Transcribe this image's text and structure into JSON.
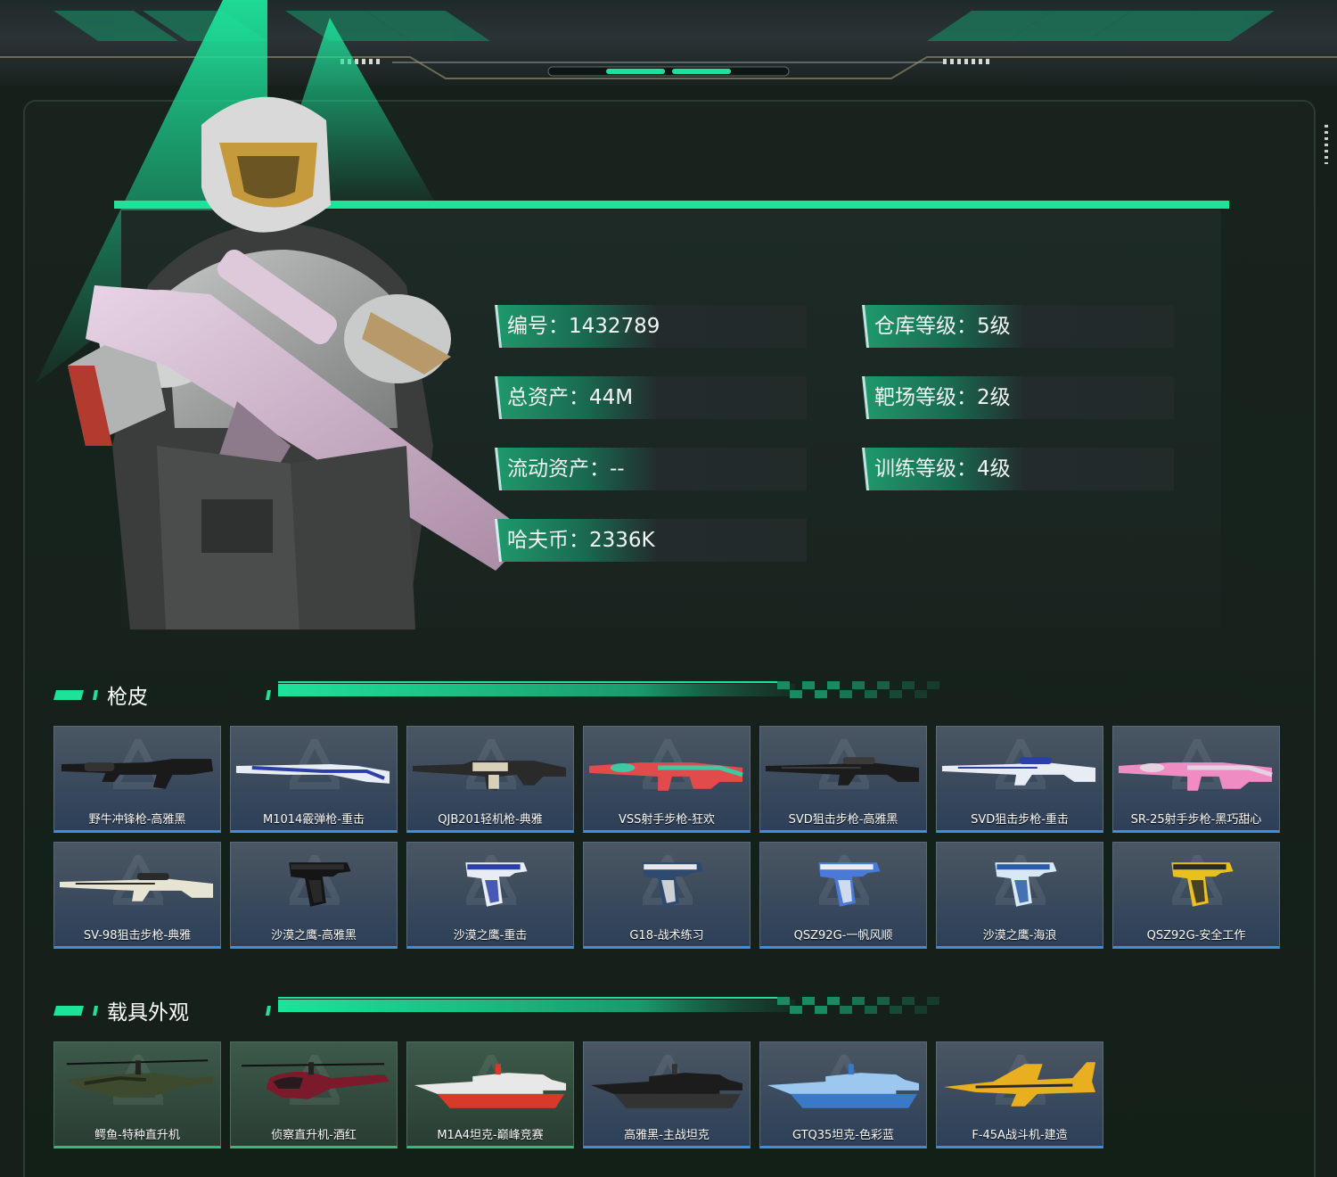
{
  "stats": {
    "id": "编号：1432789",
    "total_assets": "总资产：44M",
    "liquid_assets": "流动资产：--",
    "hafu_coin": "哈夫币：2336K",
    "warehouse_level": "仓库等级：5级",
    "range_level": "靶场等级：2级",
    "training_level": "训练等级：4级"
  },
  "sections": {
    "gun_skins": {
      "title": "枪皮",
      "items": [
        {
          "label": "野牛冲锋枪-高雅黑",
          "icon": "smg-icon",
          "colors": [
            "#1a1a1a",
            "#333"
          ]
        },
        {
          "label": "M1014霰弹枪-重击",
          "icon": "shotgun-icon",
          "colors": [
            "#e8ecf4",
            "#2a3fa8"
          ]
        },
        {
          "label": "QJB201轻机枪-典雅",
          "icon": "lmg-icon",
          "colors": [
            "#2a2a2a",
            "#d8d0b8"
          ]
        },
        {
          "label": "VSS射手步枪-狂欢",
          "icon": "marksman-rifle-icon",
          "colors": [
            "#e24b4b",
            "#3fc9a2"
          ]
        },
        {
          "label": "SVD狙击步枪-高雅黑",
          "icon": "sniper-rifle-icon",
          "colors": [
            "#1c1c1c",
            "#3a3a3a"
          ]
        },
        {
          "label": "SVD狙击步枪-重击",
          "icon": "sniper-rifle-icon",
          "colors": [
            "#e8ecf4",
            "#2a3fa8"
          ]
        },
        {
          "label": "SR-25射手步枪-黑巧甜心",
          "icon": "marksman-rifle-icon",
          "colors": [
            "#f08cc4",
            "#e4d2e2"
          ]
        },
        {
          "label": "SV-98狙击步枪-典雅",
          "icon": "sniper-rifle-icon",
          "colors": [
            "#e8e4d4",
            "#2a2a2a"
          ]
        },
        {
          "label": "沙漠之鹰-高雅黑",
          "icon": "pistol-icon",
          "colors": [
            "#151515",
            "#2c2c2c"
          ]
        },
        {
          "label": "沙漠之鹰-重击",
          "icon": "pistol-icon",
          "colors": [
            "#e8ecf4",
            "#2a3fa8"
          ]
        },
        {
          "label": "G18-战术练习",
          "icon": "pistol-icon",
          "colors": [
            "#2e4a6e",
            "#e8e8e8"
          ]
        },
        {
          "label": "QSZ92G-一帆风顺",
          "icon": "pistol-icon",
          "colors": [
            "#4a7ad8",
            "#e8ecf4"
          ]
        },
        {
          "label": "沙漠之鹰-海浪",
          "icon": "pistol-icon",
          "colors": [
            "#d8e8f4",
            "#2a5aa8"
          ]
        },
        {
          "label": "QSZ92G-安全工作",
          "icon": "pistol-icon",
          "colors": [
            "#e8c020",
            "#2a2a2a"
          ]
        }
      ]
    },
    "vehicle_skins": {
      "title": "载具外观",
      "items": [
        {
          "label": "鳄鱼-特种直升机",
          "icon": "attack-helicopter-icon",
          "colors": [
            "#3d4a2e",
            "#242b1c"
          ],
          "frame": "green"
        },
        {
          "label": "侦察直升机-酒红",
          "icon": "scout-helicopter-icon",
          "colors": [
            "#7a1a2a",
            "#2a1a1e"
          ],
          "frame": "green"
        },
        {
          "label": "M1A4坦克-巅峰竞赛",
          "icon": "tank-icon",
          "colors": [
            "#e8e8e8",
            "#d83a2a"
          ],
          "frame": "green"
        },
        {
          "label": "高雅黑-主战坦克",
          "icon": "tank-icon",
          "colors": [
            "#1c1c1c",
            "#333"
          ],
          "frame": "blue"
        },
        {
          "label": "GTQ35坦克-色彩蓝",
          "icon": "tank-icon",
          "colors": [
            "#9cc8f0",
            "#3a78c8"
          ],
          "frame": "blue"
        },
        {
          "label": "F-45A战斗机-建造",
          "icon": "fighter-jet-icon",
          "colors": [
            "#e8b020",
            "#2a2a2a"
          ],
          "frame": "blue"
        }
      ]
    }
  },
  "theme": {
    "accent": "#1de39a",
    "blue_border": "#3c8fe0",
    "green_border": "#2fbd7c"
  }
}
